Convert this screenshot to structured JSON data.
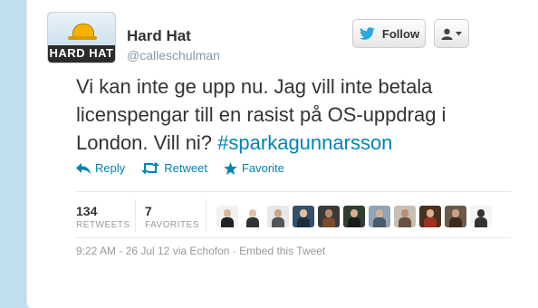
{
  "user": {
    "name": "Hard Hat",
    "handle": "@calleschulman",
    "avatar_text": "HARD HAT"
  },
  "buttons": {
    "follow_label": "Follow",
    "user_menu_icon": "user-dropdown-icon"
  },
  "tweet": {
    "text": "Vi kan inte ge upp nu. Jag vill inte betala licenspengar till en rasist på OS-uppdrag i London. Vill ni?",
    "hashtag": "#sparkagunnarsson"
  },
  "actions": {
    "reply": "Reply",
    "retweet": "Retweet",
    "favorite": "Favorite"
  },
  "stats": {
    "retweets_count": "134",
    "retweets_label": "RETWEETS",
    "favorites_count": "7",
    "favorites_label": "FAVORITES"
  },
  "favoriters": [
    {
      "name": "favoriter-1",
      "bg": "#f2f2f2",
      "head": "#d9b79c",
      "body": "#222222"
    },
    {
      "name": "favoriter-2",
      "bg": "#ffffff",
      "head": "#e2c2a5",
      "body": "#333333"
    },
    {
      "name": "favoriter-3",
      "bg": "#e8e8e8",
      "head": "#c9a58a",
      "body": "#555555"
    },
    {
      "name": "favoriter-4",
      "bg": "#35506b",
      "head": "#e0c0a0",
      "body": "#1d2d3d"
    },
    {
      "name": "favoriter-5",
      "bg": "#3a3a3a",
      "head": "#b98a6a",
      "body": "#7a4b2b"
    },
    {
      "name": "favoriter-6",
      "bg": "#2f3f2f",
      "head": "#d8b090",
      "body": "#1a1a1a"
    },
    {
      "name": "favoriter-7",
      "bg": "#8fa4b8",
      "head": "#d4b090",
      "body": "#4a5a6a"
    },
    {
      "name": "favoriter-8",
      "bg": "#c8c0b0",
      "head": "#b89070",
      "body": "#6a5040"
    },
    {
      "name": "favoriter-9",
      "bg": "#4a3020",
      "head": "#e0b090",
      "body": "#a03020"
    },
    {
      "name": "favoriter-10",
      "bg": "#6a5a4a",
      "head": "#d0a080",
      "body": "#3a2a1a"
    },
    {
      "name": "favoriter-11",
      "bg": "#f4f4f4",
      "head": "#333333",
      "body": "#333333"
    }
  ],
  "meta": {
    "line": "9:22 AM - 26 Jul 12 via Echofon · Embed this Tweet"
  },
  "colors": {
    "background": "#c0deed",
    "link": "#0084b4",
    "twitter_blue": "#2aa9e0"
  }
}
